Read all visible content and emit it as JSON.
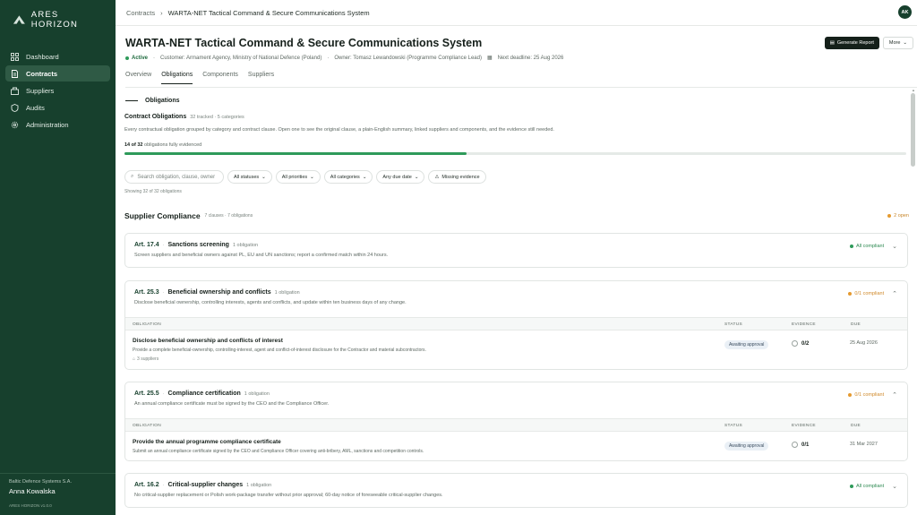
{
  "brand": {
    "name": "ARES HORIZON"
  },
  "nav": [
    {
      "label": "Dashboard",
      "icon": "dashboard-icon"
    },
    {
      "label": "Contracts",
      "icon": "contract-icon",
      "active": true
    },
    {
      "label": "Suppliers",
      "icon": "suppliers-icon"
    },
    {
      "label": "Audits",
      "icon": "audit-icon"
    },
    {
      "label": "Administration",
      "icon": "gear-icon"
    }
  ],
  "footer": {
    "org": "Baltic Defence Systems S.A.",
    "user": "Anna Kowalska",
    "version": "ARES HORIZON v1.0.0"
  },
  "breadcrumb": {
    "root": "Contracts",
    "current": "WARTA-NET Tactical Command & Secure Communications System"
  },
  "avatar": "AK",
  "header": {
    "title": "WARTA-NET Tactical Command & Secure Communications System",
    "generate_label": "Generate Report",
    "more_label": "More",
    "status": "Active",
    "customer": "Customer: Armament Agency, Ministry of National Defence (Poland)",
    "owner": "Owner: Tomasz Lewandowski (Programme Compliance Lead)",
    "deadline": "Next deadline: 25 Aug 2026"
  },
  "tabs": [
    "Overview",
    "Obligations",
    "Components",
    "Suppliers"
  ],
  "obligations": {
    "section_label": "Obligations",
    "title": "Contract Obligations",
    "summary": "32 tracked · 5 categories",
    "description": "Every contractual obligation grouped by category and contract clause. Open one to see the original clause, a plain-English summary, linked suppliers and components, and the evidence still needed.",
    "progress_done": "14 of 32",
    "progress_suffix": "obligations fully evidenced",
    "progress_fraction": 0.4375
  },
  "filters": {
    "search_placeholder": "Search obligation, clause, owner",
    "statuses": "All statuses",
    "priorities": "All priorities",
    "categories": "All categories",
    "due": "Any due date",
    "missing": "Missing evidence"
  },
  "showing": "Showing 32 of 32 obligations",
  "group": {
    "title": "Supplier Compliance",
    "sub": "7 clauses · 7 obligations",
    "open": "2 open"
  },
  "table_headers": {
    "obligation": "OBLIGATION",
    "status": "STATUS",
    "evidence": "EVIDENCE",
    "due": "DUE"
  },
  "clauses": [
    {
      "art": "Art. 17.4",
      "title": "Sanctions screening",
      "count": "1 obligation",
      "desc": "Screen suppliers and beneficial owners against PL, EU and UN sanctions; report a confirmed match within 24 hours.",
      "compliance": "All compliant"
    },
    {
      "art": "Art. 25.3",
      "title": "Beneficial ownership and conflicts",
      "count": "1 obligation",
      "desc": "Disclose beneficial ownership, controlling interests, agents and conflicts, and update within ten business days of any change.",
      "compliance": "0/1 compliant",
      "row": {
        "title": "Disclose beneficial ownership and conflicts of interest",
        "desc": "Provide a complete beneficial-ownership, controlling-interest, agent and conflict-of-interest disclosure for the Contractor and material subcontractors.",
        "suppliers": "3 suppliers",
        "status": "Awaiting approval",
        "evidence": "0/2",
        "due": "25 Aug 2026"
      }
    },
    {
      "art": "Art. 25.5",
      "title": "Compliance certification",
      "count": "1 obligation",
      "desc": "An annual compliance certificate must be signed by the CEO and the Compliance Officer.",
      "compliance": "0/1 compliant",
      "row": {
        "title": "Provide the annual programme compliance certificate",
        "desc": "Submit an annual compliance certificate signed by the CEO and Compliance Officer covering anti-bribery, AML, sanctions and competition controls.",
        "status": "Awaiting approval",
        "evidence": "0/1",
        "due": "31 Mar 2027"
      }
    },
    {
      "art": "Art. 16.2",
      "title": "Critical-supplier changes",
      "count": "1 obligation",
      "desc": "No critical-supplier replacement or Polish work-package transfer without prior approval; 60-day notice of foreseeable critical-supplier changes.",
      "compliance": "All compliant"
    }
  ],
  "colors": {
    "sidebar": "#17402d",
    "accent_green": "#2e9a5a",
    "warning": "#e59a2f"
  }
}
